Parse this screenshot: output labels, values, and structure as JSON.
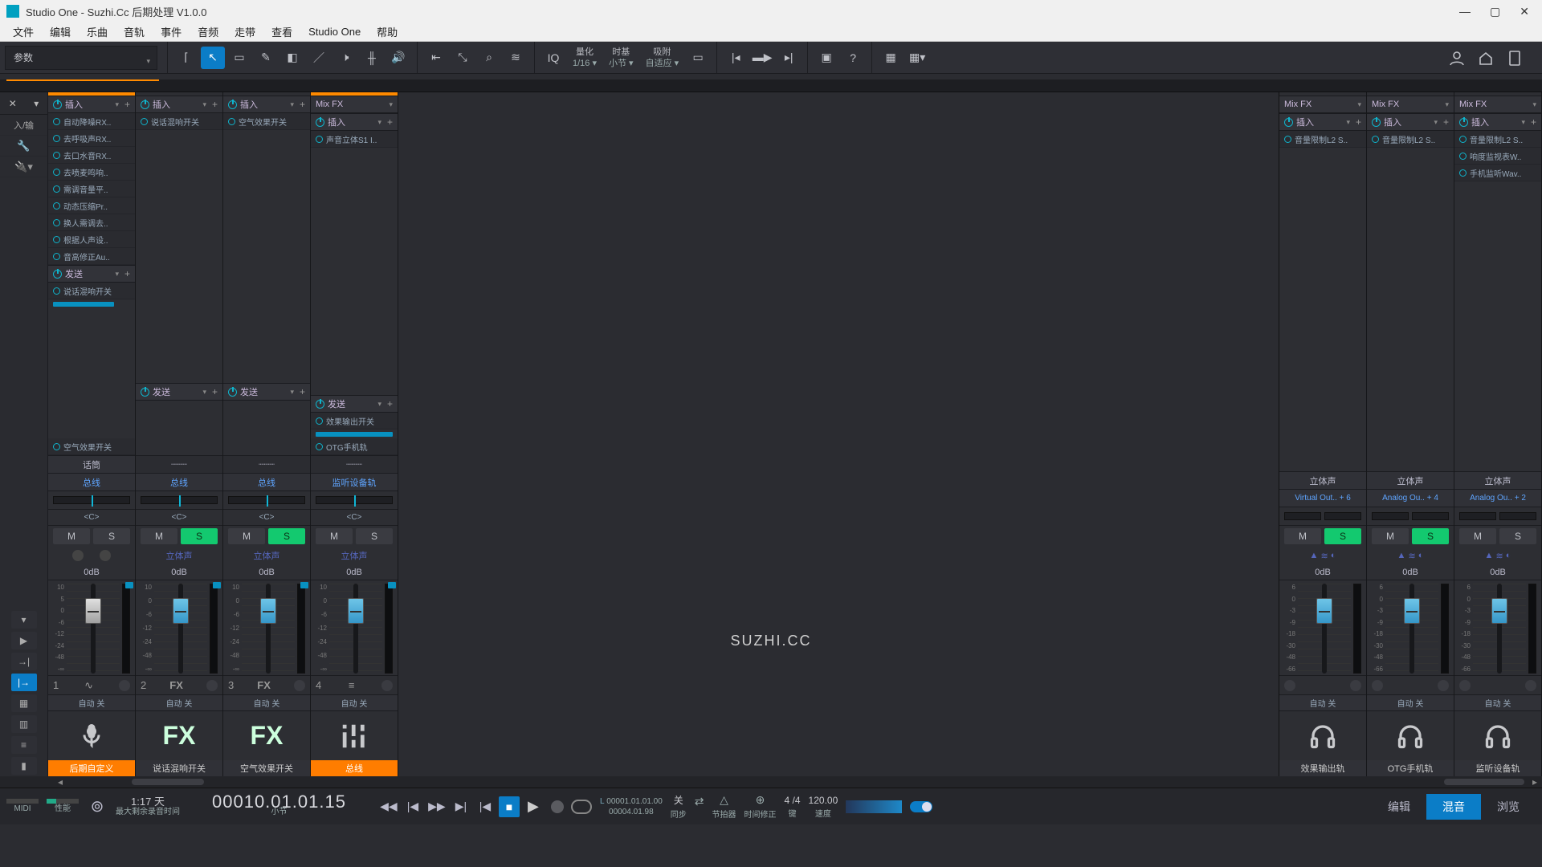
{
  "window": {
    "title": "Studio One - Suzhi.Cc 后期处理 V1.0.0"
  },
  "menu": [
    "文件",
    "编辑",
    "乐曲",
    "音轨",
    "事件",
    "音频",
    "走带",
    "查看",
    "Studio One",
    "帮助"
  ],
  "toolbar": {
    "param": "参数",
    "iq": "IQ",
    "quantize": {
      "label": "量化",
      "value": "1/16"
    },
    "timebase": {
      "label": "时基",
      "value": "小节"
    },
    "snap": {
      "label": "吸附",
      "value": "自适应"
    }
  },
  "left": {
    "io_label": "入/输"
  },
  "ch_common": {
    "insert": "插入",
    "send": "发送",
    "mixfx": "Mix FX",
    "c": "<C>",
    "m": "M",
    "s": "S",
    "stereo": "立体声",
    "db": "0dB",
    "auto": "自动 关",
    "fx": "FX"
  },
  "ch1": {
    "inserts": [
      "自动降噪RX..",
      "去呼吸声RX..",
      "去口水音RX..",
      "去喷麦鸣响..",
      "需调音量平..",
      "动态压缩Pr..",
      "换人需调去..",
      "根据人声设..",
      "音高修正Au.."
    ],
    "sends": [
      "说话混响开关"
    ],
    "extra_send": "空气效果开关",
    "in": "话筒",
    "out": "总线",
    "num": "1",
    "name": "后期自定义"
  },
  "ch2": {
    "out": "总线",
    "num": "2",
    "name": "说话混响开关"
  },
  "ch3": {
    "out": "总线",
    "num": "3",
    "name": "空气效果开关",
    "inserts": [
      "空气效果开关"
    ]
  },
  "ch4": {
    "inserts": [
      "声音立体S1 I.."
    ],
    "sends": [
      "效果输出开关",
      "OTG手机轨"
    ],
    "out": "监听设备轨",
    "num": "4",
    "name": "总线"
  },
  "r1": {
    "inserts": [
      "音量限制L2 S.."
    ],
    "out": "Virtual Out.. + 6",
    "name": "效果输出轨"
  },
  "r2": {
    "inserts": [
      "音量限制L2 S.."
    ],
    "out": "Analog Ou.. + 4",
    "name": "OTG手机轨"
  },
  "r3": {
    "inserts": [
      "音量限制L2 S..",
      "响度监视表W..",
      "手机监听Wav.."
    ],
    "out": "Analog Ou.. + 2",
    "name": "监听设备轨"
  },
  "r_common": {
    "stereo": "立体声"
  },
  "transport": {
    "midi": "MIDI",
    "perf": "性能",
    "remain": {
      "val": "1:17 天",
      "label": "最大剩余录音时间"
    },
    "maintime": "00010.01.01.15",
    "maintime_label": "小节",
    "loop": {
      "start": "00001.01.01.00",
      "end": "00004.01.98",
      "L": "L"
    },
    "sync": {
      "val": "关",
      "label": "同步"
    },
    "precount": {
      "label": "节拍器"
    },
    "offset": {
      "label": "时间修正"
    },
    "sig": {
      "val": "4 /4",
      "label": "键"
    },
    "tempo": {
      "val": "120.00",
      "label": "速度"
    },
    "tabs": {
      "edit": "编辑",
      "mix": "混音",
      "browse": "浏览"
    }
  },
  "watermark": "SUZHI.CC"
}
